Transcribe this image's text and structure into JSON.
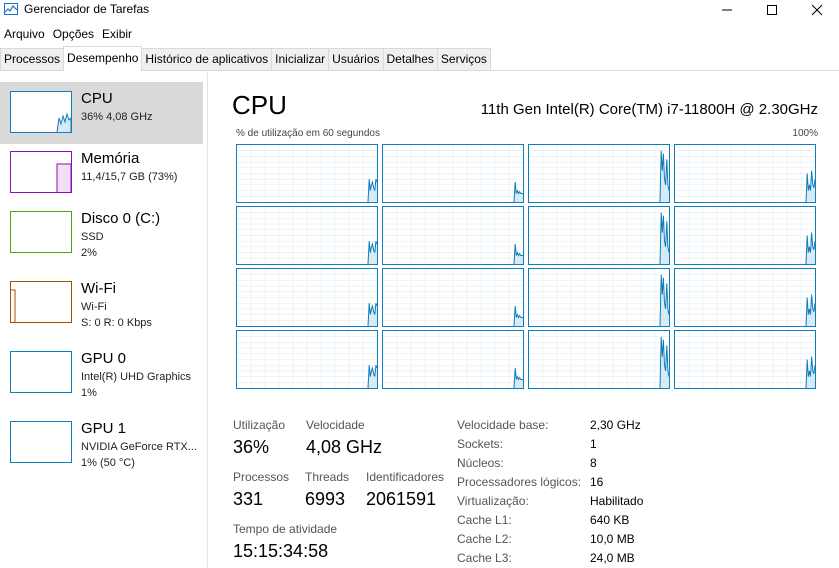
{
  "window": {
    "title": "Gerenciador de Tarefas"
  },
  "menu": [
    "Arquivo",
    "Opções",
    "Exibir"
  ],
  "tabs": [
    "Processos",
    "Desempenho",
    "Histórico de aplicativos",
    "Inicializar",
    "Usuários",
    "Detalhes",
    "Serviços"
  ],
  "sidebar": [
    {
      "name": "CPU",
      "sub1": "36% 4,08 GHz",
      "sub2": "",
      "color": "#117dbb"
    },
    {
      "name": "Memória",
      "sub1": "11,4/15,7 GB (73%)",
      "sub2": "",
      "color": "#8b12ae"
    },
    {
      "name": "Disco 0 (C:)",
      "sub1": "SSD",
      "sub2": "2%",
      "color": "#4da60c"
    },
    {
      "name": "Wi-Fi",
      "sub1": "Wi-Fi",
      "sub2_prefix": "S: 0 R: 0 Kbps",
      "color": "#a74f01"
    },
    {
      "name": "GPU 0",
      "sub1": "Intel(R) UHD Graphics",
      "sub2": "1%",
      "color": "#117dbb"
    },
    {
      "name": "GPU 1",
      "sub1": "NVIDIA GeForce RTX...",
      "sub2": "1% (50 °C)",
      "color": "#117dbb"
    }
  ],
  "main": {
    "title": "CPU",
    "model": "11th Gen Intel(R) Core(TM) i7-11800H @ 2.30GHz",
    "axis_left": "% de utilização em 60 segundos",
    "axis_right": "100%",
    "stats": {
      "utilizacao_label": "Utilização",
      "utilizacao": "36%",
      "velocidade_label": "Velocidade",
      "velocidade": "4,08 GHz",
      "processos_label": "Processos",
      "processos": "331",
      "threads_label": "Threads",
      "threads": "6993",
      "identificadores_label": "Identificadores",
      "identificadores": "2061591",
      "tempo_label": "Tempo de atividade",
      "tempo": "15:15:34:58"
    },
    "details": [
      {
        "label": "Velocidade base:",
        "value": "2,30 GHz"
      },
      {
        "label": "Sockets:",
        "value": "1"
      },
      {
        "label": "Núcleos:",
        "value": "8"
      },
      {
        "label": "Processadores lógicos:",
        "value": "16"
      },
      {
        "label": "Virtualização:",
        "value": "Habilitado"
      },
      {
        "label": "Cache L1:",
        "value": "640 KB"
      },
      {
        "label": "Cache L2:",
        "value": "10,0 MB"
      },
      {
        "label": "Cache L3:",
        "value": "24,0 MB"
      }
    ]
  },
  "chart_data": {
    "type": "area",
    "title": "% de utilização em 60 segundos",
    "ylim": [
      0,
      100
    ],
    "cores": 16,
    "series": [
      {
        "values": [
          0,
          0,
          0,
          0,
          0,
          0,
          0,
          0,
          0,
          0,
          0,
          0,
          0,
          0,
          0,
          0,
          0,
          0,
          0,
          0,
          0,
          0,
          0,
          0,
          0,
          0,
          0,
          0,
          0,
          0,
          0,
          0,
          0,
          0,
          0,
          0,
          0,
          0,
          0,
          0,
          0,
          0,
          0,
          0,
          0,
          0,
          0,
          0,
          0,
          0,
          0,
          0,
          0,
          0,
          0,
          0,
          0,
          0,
          0,
          0,
          0,
          0,
          0,
          0,
          0,
          0,
          0,
          0,
          0,
          0,
          0,
          0,
          0,
          0,
          0,
          0,
          0,
          0,
          0,
          0,
          0,
          0,
          0,
          0,
          0,
          0,
          0,
          0,
          0,
          0,
          0,
          0,
          0,
          0,
          0,
          0,
          0,
          0,
          0,
          0,
          0,
          0,
          0,
          0,
          0,
          0,
          0,
          0,
          0,
          0,
          0,
          0,
          0,
          0,
          0,
          0,
          0,
          0,
          40,
          20,
          30,
          35,
          25,
          20,
          40,
          35
        ]
      },
      {
        "values": [
          0,
          0,
          0,
          0,
          0,
          0,
          0,
          0,
          0,
          0,
          0,
          0,
          0,
          0,
          0,
          0,
          0,
          0,
          0,
          0,
          0,
          0,
          0,
          0,
          0,
          0,
          0,
          0,
          0,
          0,
          0,
          0,
          0,
          0,
          0,
          0,
          0,
          0,
          0,
          0,
          0,
          0,
          0,
          0,
          0,
          0,
          0,
          0,
          0,
          0,
          0,
          0,
          0,
          0,
          0,
          0,
          0,
          0,
          0,
          0,
          0,
          0,
          0,
          0,
          0,
          0,
          0,
          0,
          0,
          0,
          0,
          0,
          0,
          0,
          0,
          0,
          0,
          0,
          0,
          0,
          0,
          0,
          0,
          0,
          0,
          0,
          0,
          0,
          0,
          0,
          0,
          0,
          0,
          0,
          0,
          0,
          0,
          0,
          0,
          0,
          0,
          0,
          0,
          0,
          0,
          0,
          0,
          0,
          0,
          0,
          0,
          0,
          0,
          0,
          0,
          0,
          0,
          0,
          35,
          15,
          20,
          15,
          18,
          15,
          15,
          15
        ]
      },
      {
        "values": [
          0,
          0,
          0,
          0,
          0,
          0,
          0,
          0,
          0,
          0,
          0,
          0,
          0,
          0,
          0,
          0,
          0,
          0,
          0,
          0,
          0,
          0,
          0,
          0,
          0,
          0,
          0,
          0,
          0,
          0,
          0,
          0,
          0,
          0,
          0,
          0,
          0,
          0,
          0,
          0,
          0,
          0,
          0,
          0,
          0,
          0,
          0,
          0,
          0,
          0,
          0,
          0,
          0,
          0,
          0,
          0,
          0,
          0,
          0,
          0,
          0,
          0,
          0,
          0,
          0,
          0,
          0,
          0,
          0,
          0,
          0,
          0,
          0,
          0,
          0,
          0,
          0,
          0,
          0,
          0,
          0,
          0,
          0,
          0,
          0,
          0,
          0,
          0,
          0,
          0,
          0,
          0,
          0,
          0,
          0,
          0,
          0,
          0,
          0,
          0,
          0,
          0,
          0,
          0,
          0,
          0,
          0,
          0,
          0,
          0,
          0,
          0,
          0,
          0,
          0,
          0,
          0,
          0,
          90,
          55,
          85,
          40,
          30,
          75,
          30,
          20
        ]
      },
      {
        "values": [
          0,
          0,
          0,
          0,
          0,
          0,
          0,
          0,
          0,
          0,
          0,
          0,
          0,
          0,
          0,
          0,
          0,
          0,
          0,
          0,
          0,
          0,
          0,
          0,
          0,
          0,
          0,
          0,
          0,
          0,
          0,
          0,
          0,
          0,
          0,
          0,
          0,
          0,
          0,
          0,
          0,
          0,
          0,
          0,
          0,
          0,
          0,
          0,
          0,
          0,
          0,
          0,
          0,
          0,
          0,
          0,
          0,
          0,
          0,
          0,
          0,
          0,
          0,
          0,
          0,
          0,
          0,
          0,
          0,
          0,
          0,
          0,
          0,
          0,
          0,
          0,
          0,
          0,
          0,
          0,
          0,
          0,
          0,
          0,
          0,
          0,
          0,
          0,
          0,
          0,
          0,
          0,
          0,
          0,
          0,
          0,
          0,
          0,
          0,
          0,
          0,
          0,
          0,
          0,
          0,
          0,
          0,
          0,
          0,
          0,
          0,
          0,
          0,
          0,
          0,
          0,
          0,
          0,
          50,
          20,
          30,
          20,
          55,
          30,
          25,
          40
        ]
      }
    ]
  }
}
